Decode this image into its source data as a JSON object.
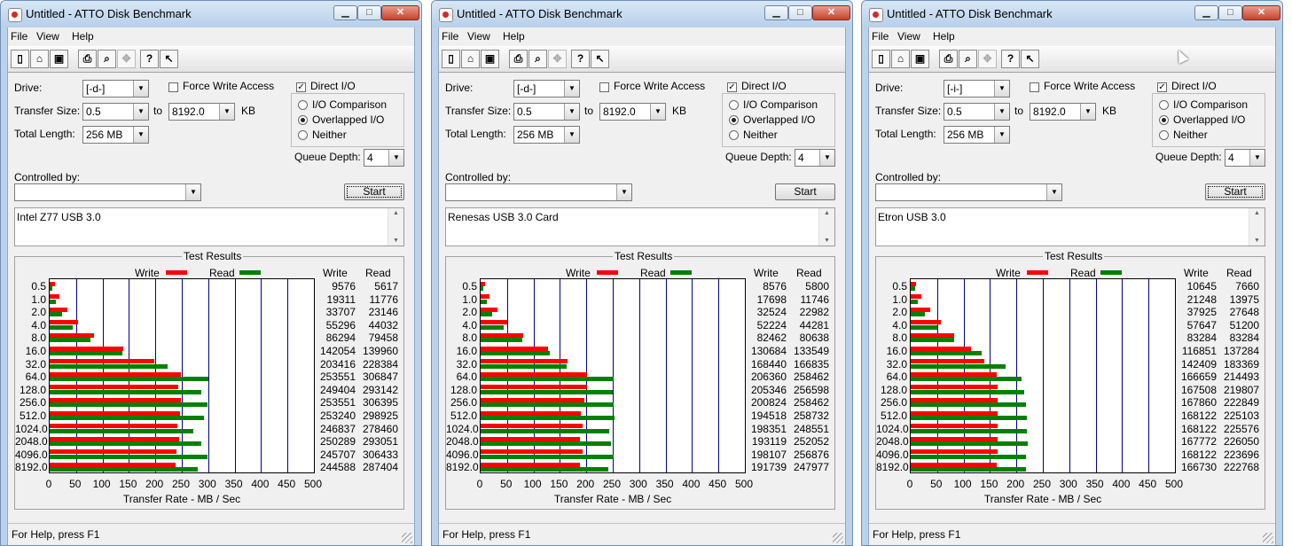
{
  "windows": [
    {
      "title": "Untitled - ATTO Disk Benchmark",
      "menus": [
        "File",
        "View",
        "Help"
      ],
      "drive_label": "Drive:",
      "drive": "[-d-]",
      "transfer_label": "Transfer Size:",
      "transfer_from": "0.5",
      "to_label": "to",
      "transfer_to": "8192.0",
      "kb_label": "KB",
      "length_label": "Total Length:",
      "total_length": "256 MB",
      "force_write_label": "Force Write Access",
      "direct_io_label": "Direct I/O",
      "io_comparison_label": "I/O Comparison",
      "overlapped_label": "Overlapped I/O",
      "neither_label": "Neither",
      "queue_label": "Queue Depth:",
      "queue_depth": "4",
      "controlled_label": "Controlled by:",
      "start_label": "Start",
      "description": "Intel Z77 USB 3.0",
      "results_title": "Test Results",
      "write_legend": "Write",
      "read_legend": "Read",
      "write_header": "Write",
      "read_header": "Read",
      "axis_title": "Transfer Rate - MB / Sec",
      "status": "For Help, press F1",
      "colors": {
        "write": "#ff0000",
        "read": "#008000",
        "grid": "#00008b"
      },
      "chart_data": {
        "type": "bar",
        "categories": [
          "0.5",
          "1.0",
          "2.0",
          "4.0",
          "8.0",
          "16.0",
          "32.0",
          "64.0",
          "128.0",
          "256.0",
          "512.0",
          "1024.0",
          "2048.0",
          "4096.0",
          "8192.0"
        ],
        "series": [
          {
            "name": "Write",
            "values": [
              9576,
              19311,
              33707,
              55296,
              86294,
              142054,
              203416,
              253551,
              249404,
              253551,
              253240,
              246837,
              250289,
              245707,
              244588
            ]
          },
          {
            "name": "Read",
            "values": [
              5617,
              11776,
              23146,
              44032,
              79458,
              139960,
              228384,
              306847,
              293142,
              306395,
              298925,
              278460,
              293051,
              306433,
              287404
            ]
          }
        ],
        "xlabel": "Transfer Rate - MB / Sec",
        "xlim": [
          0,
          500
        ],
        "xticks": [
          "0",
          "50",
          "100",
          "150",
          "200",
          "250",
          "300",
          "350",
          "400",
          "450",
          "500"
        ],
        "grid": true,
        "legend": "top"
      }
    },
    {
      "title": "Untitled - ATTO Disk Benchmark",
      "menus": [
        "File",
        "View",
        "Help"
      ],
      "drive_label": "Drive:",
      "drive": "[-d-]",
      "transfer_label": "Transfer Size:",
      "transfer_from": "0.5",
      "to_label": "to",
      "transfer_to": "8192.0",
      "kb_label": "KB",
      "length_label": "Total Length:",
      "total_length": "256 MB",
      "force_write_label": "Force Write Access",
      "direct_io_label": "Direct I/O",
      "io_comparison_label": "I/O Comparison",
      "overlapped_label": "Overlapped I/O",
      "neither_label": "Neither",
      "queue_label": "Queue Depth:",
      "queue_depth": "4",
      "controlled_label": "Controlled by:",
      "start_label": "Start",
      "description": "Renesas USB 3.0 Card",
      "results_title": "Test Results",
      "write_legend": "Write",
      "read_legend": "Read",
      "write_header": "Write",
      "read_header": "Read",
      "axis_title": "Transfer Rate - MB / Sec",
      "status": "For Help, press F1",
      "colors": {
        "write": "#ff0000",
        "read": "#008000",
        "grid": "#00008b"
      },
      "chart_data": {
        "type": "bar",
        "categories": [
          "0.5",
          "1.0",
          "2.0",
          "4.0",
          "8.0",
          "16.0",
          "32.0",
          "64.0",
          "128.0",
          "256.0",
          "512.0",
          "1024.0",
          "2048.0",
          "4096.0",
          "8192.0"
        ],
        "series": [
          {
            "name": "Write",
            "values": [
              8576,
              17698,
              32524,
              52224,
              82462,
              130684,
              168440,
              206360,
              205346,
              200824,
              194518,
              198351,
              193119,
              198107,
              191739
            ]
          },
          {
            "name": "Read",
            "values": [
              5800,
              11746,
              22982,
              44281,
              80638,
              133549,
              166835,
              258462,
              256598,
              258462,
              258732,
              248551,
              252052,
              256876,
              247977
            ]
          }
        ],
        "xlabel": "Transfer Rate - MB / Sec",
        "xlim": [
          0,
          500
        ],
        "xticks": [
          "0",
          "50",
          "100",
          "150",
          "200",
          "250",
          "300",
          "350",
          "400",
          "450",
          "500"
        ],
        "grid": true,
        "legend": "top"
      }
    },
    {
      "title": "Untitled - ATTO Disk Benchmark",
      "menus": [
        "File",
        "View",
        "Help"
      ],
      "drive_label": "Drive:",
      "drive": "[-i-]",
      "transfer_label": "Transfer Size:",
      "transfer_from": "0.5",
      "to_label": "to",
      "transfer_to": "8192.0",
      "kb_label": "KB",
      "length_label": "Total Length:",
      "total_length": "256 MB",
      "force_write_label": "Force Write Access",
      "direct_io_label": "Direct I/O",
      "io_comparison_label": "I/O Comparison",
      "overlapped_label": "Overlapped I/O",
      "neither_label": "Neither",
      "queue_label": "Queue Depth:",
      "queue_depth": "4",
      "controlled_label": "Controlled by:",
      "start_label": "Start",
      "description": "Etron USB 3.0",
      "results_title": "Test Results",
      "write_legend": "Write",
      "read_legend": "Read",
      "write_header": "Write",
      "read_header": "Read",
      "axis_title": "Transfer Rate - MB / Sec",
      "status": "For Help, press F1",
      "colors": {
        "write": "#ff0000",
        "read": "#008000",
        "grid": "#00008b"
      },
      "chart_data": {
        "type": "bar",
        "categories": [
          "0.5",
          "1.0",
          "2.0",
          "4.0",
          "8.0",
          "16.0",
          "32.0",
          "64.0",
          "128.0",
          "256.0",
          "512.0",
          "1024.0",
          "2048.0",
          "4096.0",
          "8192.0"
        ],
        "series": [
          {
            "name": "Write",
            "values": [
              10645,
              21248,
              37925,
              57647,
              83284,
              116851,
              142409,
              166659,
              167508,
              167860,
              168122,
              168122,
              167772,
              168122,
              166730
            ]
          },
          {
            "name": "Read",
            "values": [
              7660,
              13975,
              27648,
              51200,
              83284,
              137284,
              183369,
              214493,
              219807,
              222849,
              225103,
              225576,
              226050,
              223696,
              222768
            ]
          }
        ],
        "xlabel": "Transfer Rate - MB / Sec",
        "xlim": [
          0,
          500
        ],
        "xticks": [
          "0",
          "50",
          "100",
          "150",
          "200",
          "250",
          "300",
          "350",
          "400",
          "450",
          "500"
        ],
        "grid": true,
        "legend": "top"
      }
    }
  ]
}
